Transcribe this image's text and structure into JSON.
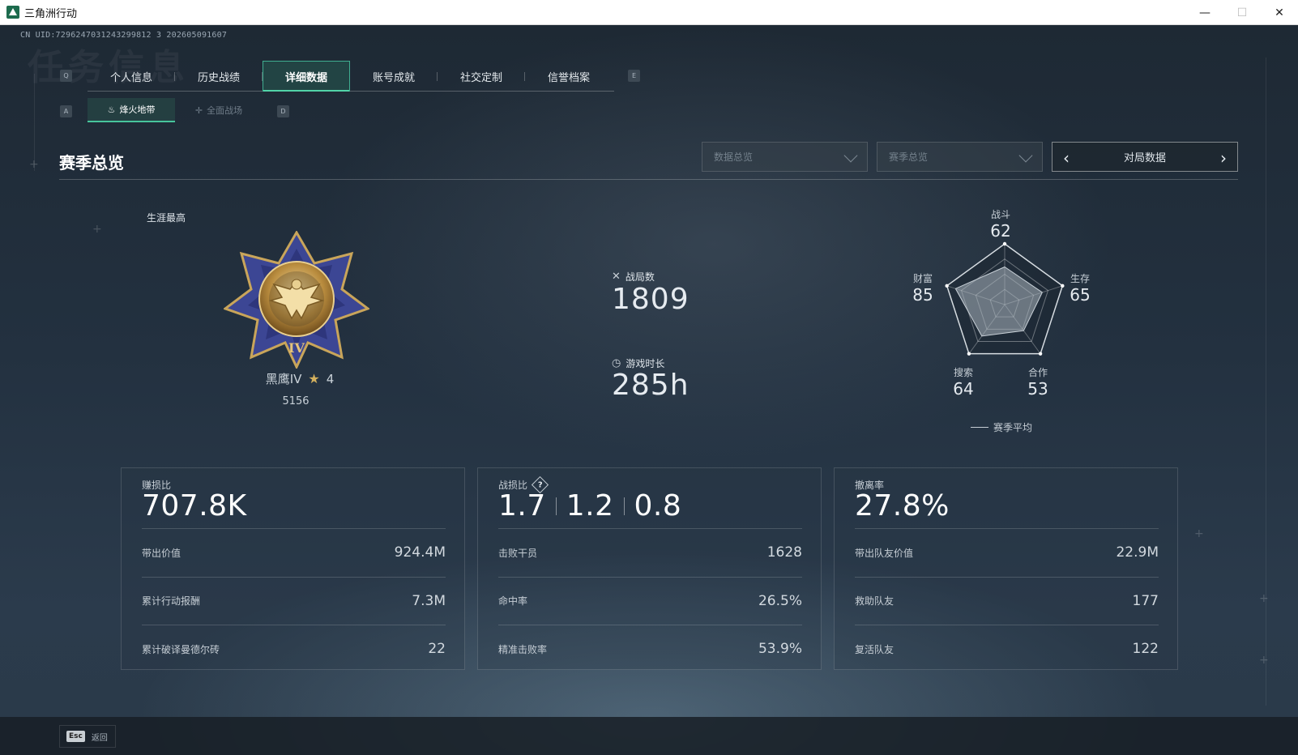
{
  "window": {
    "title": "三角洲行动",
    "minimize": "—",
    "maximize": "☐",
    "close": "✕"
  },
  "header": {
    "uid": "CN UID:7296247031243299812 3 202605091607",
    "watermark": "任务信息"
  },
  "keys": {
    "tab_prev": "Q",
    "tab_next": "E",
    "sub_prev": "A",
    "sub_next": "D"
  },
  "tabs": [
    {
      "label": "个人信息"
    },
    {
      "label": "历史战绩"
    },
    {
      "label": "详细数据",
      "active": true
    },
    {
      "label": "账号成就"
    },
    {
      "label": "社交定制"
    },
    {
      "label": "信誉档案"
    }
  ],
  "subtabs": [
    {
      "label": "烽火地带",
      "icon": "flame-icon",
      "glyph": "♨",
      "active": true
    },
    {
      "label": "全面战场",
      "icon": "crosshair-icon",
      "glyph": "✛"
    }
  ],
  "section": {
    "title": "赛季总览",
    "dropdown1": "数据总览",
    "dropdown2": "赛季总览",
    "pager_label": "对局数据",
    "prev": "‹",
    "next": "›"
  },
  "rank": {
    "career_label": "生涯最高",
    "name": "黑鹰IV",
    "stars": "4",
    "score": "5156",
    "medal_numeral": "IV"
  },
  "overview": {
    "matches_label": "战局数",
    "matches_value": "1809",
    "playtime_label": "游戏时长",
    "playtime_value": "285h"
  },
  "radar": {
    "legend": "赛季平均",
    "max": 100,
    "axes": [
      {
        "label": "战斗",
        "value": 62
      },
      {
        "label": "生存",
        "value": 65
      },
      {
        "label": "合作",
        "value": 53
      },
      {
        "label": "搜索",
        "value": 64
      },
      {
        "label": "财富",
        "value": 85
      }
    ]
  },
  "cards": [
    {
      "title": "赚损比",
      "main": "707.8K",
      "rows": [
        {
          "label": "带出价值",
          "value": "924.4M"
        },
        {
          "label": "累计行动报酬",
          "value": "7.3M"
        },
        {
          "label": "累计破译曼德尔砖",
          "value": "22"
        }
      ]
    },
    {
      "title": "战损比",
      "help": "?",
      "main_values": [
        "1.7",
        "1.2",
        "0.8"
      ],
      "rows": [
        {
          "label": "击败干员",
          "value": "1628"
        },
        {
          "label": "命中率",
          "value": "26.5%"
        },
        {
          "label": "精准击败率",
          "value": "53.9%"
        }
      ]
    },
    {
      "title": "撤离率",
      "main": "27.8%",
      "rows": [
        {
          "label": "带出队友价值",
          "value": "22.9M"
        },
        {
          "label": "救助队友",
          "value": "177"
        },
        {
          "label": "复活队友",
          "value": "122"
        }
      ]
    }
  ],
  "footer": {
    "esc_key": "Esc",
    "back_label": "返回"
  },
  "colors": {
    "accent": "#47c59c",
    "text": "#e6ebf0",
    "gold": "#d4b15e"
  }
}
